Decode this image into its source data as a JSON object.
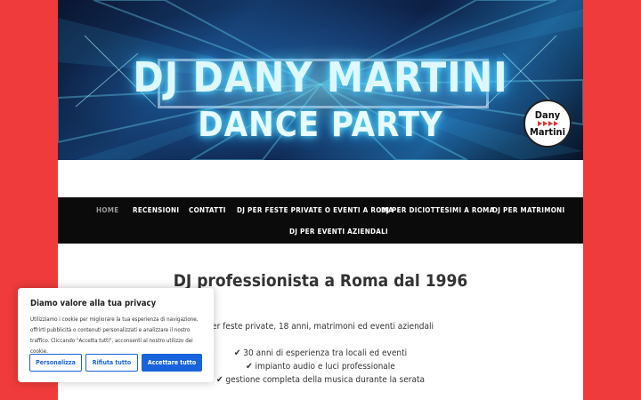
{
  "banner": {
    "title_line1": "DJ DANY MARTINI",
    "title_line2": "DANCE PARTY",
    "logo_line1": "Dany",
    "logo_line2": "Martini"
  },
  "nav": {
    "items": [
      {
        "label": "HOME",
        "active": true
      },
      {
        "label": "RECENSIONI"
      },
      {
        "label": "CONTATTI"
      },
      {
        "label": "DJ PER FESTE PRIVATE O EVENTI A ROMA"
      },
      {
        "label": "DJ PER DICIOTTESIMI A ROMA"
      },
      {
        "label": "DJ PER MATRIMONI"
      },
      {
        "label": "DJ PER EVENTI AZIENDALI"
      }
    ]
  },
  "main": {
    "headline": "DJ professionista a Roma dal 1996",
    "subline": "Per feste private, 18 anni, matrimoni ed eventi aziendali",
    "features": [
      "✔ 30 anni di esperienza tra locali ed eventi",
      "✔ impianto audio e luci professionale",
      "✔ gestione completa della musica durante la serata"
    ]
  },
  "cookie": {
    "title": "Diamo valore alla tua privacy",
    "text": "Utilizziamo i cookie per migliorare la tua esperienza di navigazione, offrirti pubblicità o contenuti personalizzati e analizzare il nostro traffico. Cliccando \"Accetta tutti\", acconsenti al nostro utilizzo dei cookie.",
    "btn_customize": "Personalizza",
    "btn_reject": "Rifiuta tutto",
    "btn_accept": "Accettare tutto"
  },
  "colors": {
    "page_bg": "#ef3b3b",
    "nav_bg": "#0b0b0b",
    "accent_blue": "#1863dc",
    "neon": "#5fe0ff"
  }
}
